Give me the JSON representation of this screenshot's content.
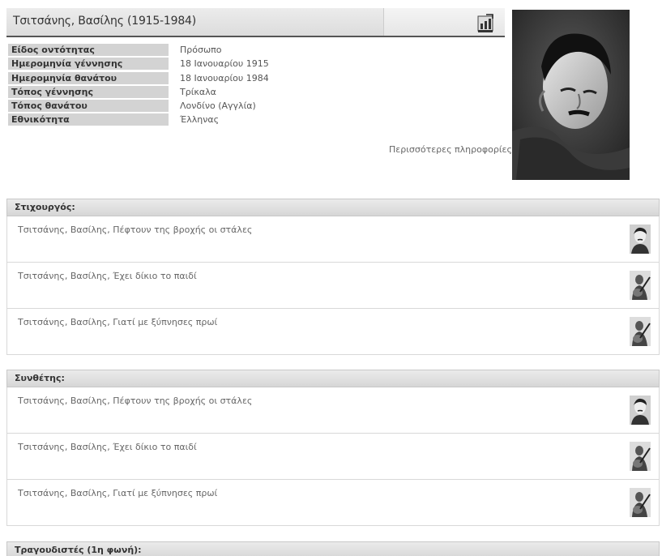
{
  "header": {
    "title": "Τσιτσάνης, Βασίλης (1915-1984)"
  },
  "info": [
    {
      "label": "Είδος οντότητας",
      "value": "Πρόσωπο"
    },
    {
      "label": "Ημερομηνία γέννησης",
      "value": "18 Ιανουαρίου 1915"
    },
    {
      "label": "Ημερομηνία θανάτου",
      "value": "18 Ιανουαρίου 1984"
    },
    {
      "label": "Τόπος γέννησης",
      "value": "Τρίκαλα"
    },
    {
      "label": "Τόπος θανάτου",
      "value": "Λονδίνο (Αγγλία)"
    },
    {
      "label": "Εθνικότητα",
      "value": "Έλληνας"
    }
  ],
  "more_info_label": "Περισσότερες πληροφορίες",
  "sections": [
    {
      "title": "Στιχουργός:",
      "items": [
        {
          "title": "Τσιτσάνης, Βασίλης, Πέφτουν της βροχής οι στάλες",
          "thumb": "portrait-thumb-icon"
        },
        {
          "title": "Τσιτσάνης, Βασίλης, Έχει δίκιο το παιδί",
          "thumb": "bouzouki-player-icon"
        },
        {
          "title": "Τσιτσάνης, Βασίλης, Γιατί με ξύπνησες πρωί",
          "thumb": "bouzouki-player-icon"
        }
      ]
    },
    {
      "title": "Συνθέτης:",
      "items": [
        {
          "title": "Τσιτσάνης, Βασίλης, Πέφτουν της βροχής οι στάλες",
          "thumb": "portrait-thumb-icon"
        },
        {
          "title": "Τσιτσάνης, Βασίλης, Έχει δίκιο το παιδί",
          "thumb": "bouzouki-player-icon"
        },
        {
          "title": "Τσιτσάνης, Βασίλης, Γιατί με ξύπνησες πρωί",
          "thumb": "bouzouki-player-icon"
        }
      ]
    },
    {
      "title": "Τραγουδιστές (1η φωνή):",
      "items": []
    }
  ]
}
